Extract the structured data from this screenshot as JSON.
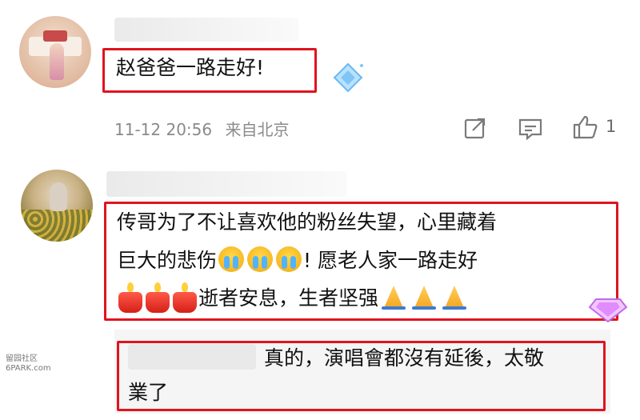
{
  "comments": [
    {
      "text": "赵爸爸一路走好!",
      "meta": {
        "date": "11-12 20:56",
        "location": "来自北京",
        "like_count": "1"
      }
    },
    {
      "line1": "传哥为了不让喜欢他的粉丝失望，心里藏着",
      "line2_text_before": "巨大的悲伤",
      "line2_text_after": "! 愿老人家一路走好",
      "line3_text": "逝者安息，生者坚强"
    }
  ],
  "reply": {
    "line1": "真的，演唱會都沒有延後，太敬",
    "line2": "業了"
  },
  "watermark": {
    "line1": "留园社区",
    "line2": "6PARK.com"
  },
  "icons": [
    "share-icon",
    "comment-icon",
    "like-icon",
    "diamond-badge-icon",
    "crying-emoji",
    "candle-emoji",
    "pray-emoji"
  ],
  "colors": {
    "highlight_red": "#e0141f",
    "meta_gray": "#8a8a8a"
  }
}
